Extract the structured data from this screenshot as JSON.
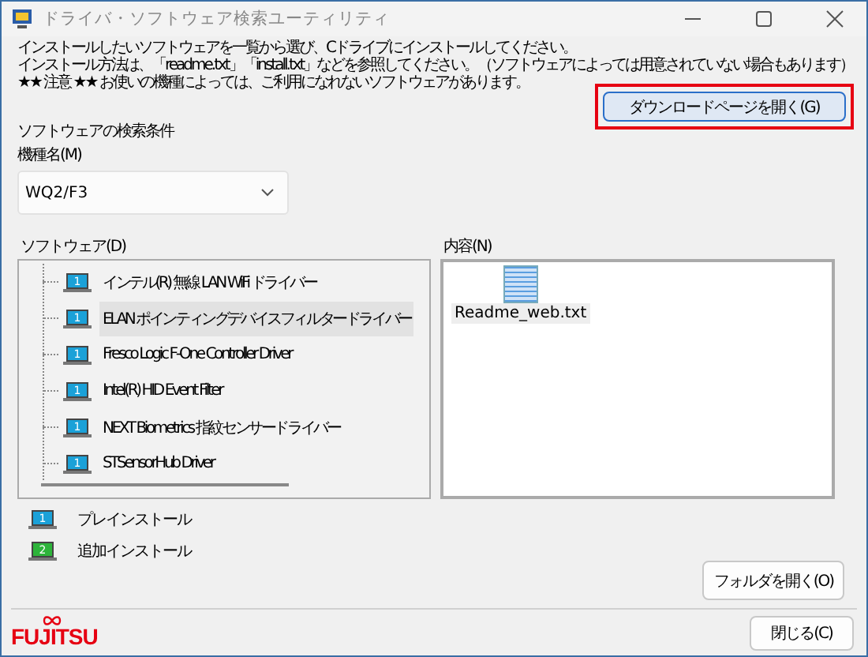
{
  "window": {
    "title": "ドライバ・ソフトウェア検索ユーティリティ"
  },
  "instructions": [
    "インストールしたいソフトウェアを一覧から選び、Cドライブにインストールしてください。",
    "インストール方法は、「readme.txt」「install.txt」などを参照してください。（ソフトウェアによっては用意されていない場合もあります）",
    "★★ 注意 ★★ お使いの機種によっては、ご利用になれないソフトウェアがあります。"
  ],
  "download_button": {
    "label": "ダウンロードページを開く(G)",
    "highlighted": true
  },
  "search_conditions": {
    "heading": "ソフトウェアの検索条件",
    "model_label": "機種名(M)",
    "model_value": "WQ2/F3"
  },
  "software": {
    "label": "ソフトウェア(D)",
    "items": [
      {
        "label": "インテル(R) 無線 LAN WiFi ドライバー",
        "kind": "preinstall",
        "badge": "1",
        "selected": false
      },
      {
        "label": "ELAN ポインティングデバイスフィルタードライバー",
        "kind": "preinstall",
        "badge": "1",
        "selected": true
      },
      {
        "label": "Fresco Logic F-One Controller Driver",
        "kind": "preinstall",
        "badge": "1",
        "selected": false
      },
      {
        "label": "Intel(R) HID Event Filter",
        "kind": "preinstall",
        "badge": "1",
        "selected": false
      },
      {
        "label": "NEXT Biometrics 指紋センサードライバー",
        "kind": "preinstall",
        "badge": "1",
        "selected": false
      },
      {
        "label": "STSensorHub Driver",
        "kind": "preinstall",
        "badge": "1",
        "selected": false
      }
    ]
  },
  "contents": {
    "label": "内容(N)",
    "files": [
      {
        "name": "Readme_web.txt"
      }
    ]
  },
  "legend": [
    {
      "label": "プレインストール",
      "kind": "preinstall",
      "badge": "1"
    },
    {
      "label": "追加インストール",
      "kind": "additional",
      "badge": "2"
    }
  ],
  "open_folder_button": {
    "label": "フォルダを開く(O)"
  },
  "logo": {
    "text": "FUJITSU"
  },
  "close_button": {
    "label": "閉じる(C)"
  }
}
